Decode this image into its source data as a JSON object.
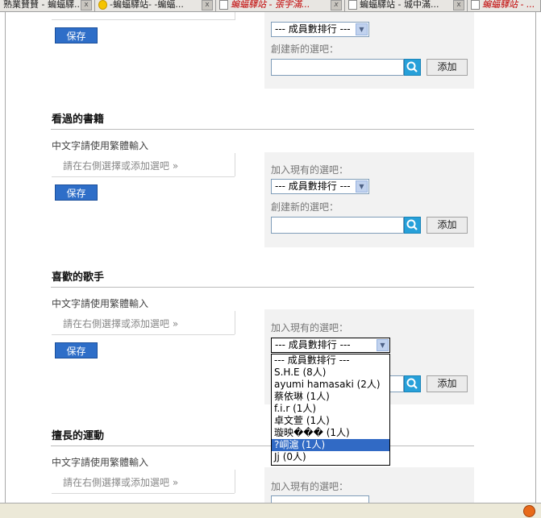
{
  "tabs": [
    {
      "label": "熟業賛賛 - 蝙蝠驛...",
      "red": false,
      "icon": "none"
    },
    {
      "label": "-蝙蝠驛站- -蝙蝠...",
      "red": false,
      "icon": "bulb"
    },
    {
      "label": "蝙蝠驛站 - 張宇滿...",
      "red": true,
      "icon": "page"
    },
    {
      "label": "蝙蝠驛站 - 城中滿...",
      "red": false,
      "icon": "page"
    },
    {
      "label": "蝙蝠驛站 - ...",
      "red": true,
      "icon": "page"
    }
  ],
  "common": {
    "save_label": "保存",
    "add_label": "添加",
    "join_label": "加入現有的選吧：",
    "create_label": "創建新的選吧：",
    "select_value": "--- 成員數排行 ---",
    "hint": "中文字請使用繁體輸入",
    "choose_text": "請在右側選擇或添加選吧 »"
  },
  "sections": [
    {
      "title": "看過的書籍"
    },
    {
      "title": "喜歡的歌手"
    },
    {
      "title": "擅長的運動"
    }
  ],
  "dropdown": {
    "options": [
      "--- 成員數排行 ---",
      "S.H.E (8人)",
      "ayumi hamasaki (2人)",
      "蔡依琳 (1人)",
      "f.i.r (1人)",
      "卓文萱 (1人)",
      "璇映��� (1人)",
      "?峒滬 (1人)",
      "Jj (0人)"
    ],
    "highlighted_index": 7
  }
}
